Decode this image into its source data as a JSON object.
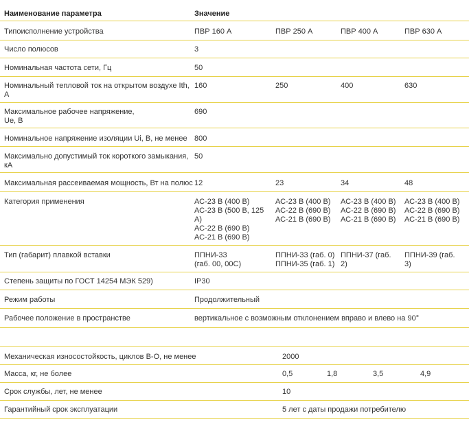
{
  "header": {
    "param": "Наименование параметра",
    "value": "Значение"
  },
  "rows1": [
    {
      "label": "Типоисполнение устройства",
      "values": [
        "ПВР 160 А",
        "ПВР 250 А",
        "ПВР 400 А",
        "ПВР 630 А"
      ]
    },
    {
      "label": "Число полюсов",
      "values": [
        "3"
      ]
    },
    {
      "label": "Номинальная частота сети, Гц",
      "values": [
        "50"
      ]
    },
    {
      "label_lines": [
        "Номинальный тепловой ток на открытом воздухе Ith,",
        "А"
      ],
      "values": [
        "160",
        "250",
        "400",
        "630"
      ]
    },
    {
      "label_lines": [
        "Максимальное рабочее напряжение,",
        "Ue, В"
      ],
      "values": [
        "690"
      ]
    },
    {
      "label": "Номинальное напряжение изоляции Ui, В, не менее",
      "values": [
        "800"
      ]
    },
    {
      "label_lines": [
        "Максимально допустимый ток короткого замыкания,",
        "кА"
      ],
      "values": [
        "50"
      ]
    },
    {
      "label": "Максимальная рассеиваемая мощность, Вт на полюс",
      "values": [
        "12",
        "23",
        "34",
        "48"
      ]
    },
    {
      "label": "Категория применения",
      "values_lines": [
        [
          "АС-23 В (400 В)",
          "АС-23 В (500 В, 125",
          "А)",
          "АС-22 В (690 В)",
          "АС-21 В (690 В)"
        ],
        [
          "АС-23 В (400 В)",
          "АС-22 В (690 В)",
          "АС-21 В (690 В)"
        ],
        [
          "АС-23 В (400 В)",
          "АС-22 В (690 В)",
          "АС-21 В (690 В)"
        ],
        [
          "АС-23 В (400 В)",
          "АС-22 В (690 В)",
          "АС-21 В (690 В)"
        ]
      ]
    },
    {
      "label": "Тип (габарит) плавкой вставки",
      "values_lines": [
        [
          "ППНИ-33",
          "(габ. 00, 00С)"
        ],
        [
          "ППНИ-33 (габ. 0)",
          "ППНИ-35 (габ. 1)"
        ],
        [
          "ППНИ-37 (габ.",
          "2)"
        ],
        [
          "ППНИ-39 (габ.",
          "3)"
        ]
      ]
    },
    {
      "label": "Степень защиты по ГОСТ 14254 МЭК 529)",
      "values": [
        "IP30"
      ]
    },
    {
      "label": "Режим работы",
      "values": [
        "Продолжительный"
      ]
    },
    {
      "label": "Рабочее положение в пространстве",
      "values": [
        "вертикальное с возможным отклонением  вправо и влево на 90°"
      ]
    }
  ],
  "rows2": [
    {
      "label": "Механическая износостойкость, циклов В-О, не менее",
      "values": [
        "2000"
      ]
    },
    {
      "label": "Масса, кг, не более",
      "values": [
        "0,5",
        "1,8",
        "3,5",
        "4,9"
      ]
    },
    {
      "label": "Срок службы, лет, не менее",
      "values": [
        "10"
      ]
    },
    {
      "label": "Гарантийный срок эксплуатации",
      "values": [
        "5 лет с даты продажи потребителю"
      ]
    }
  ]
}
